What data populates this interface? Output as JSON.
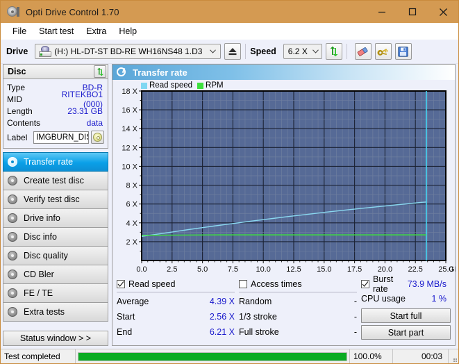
{
  "window": {
    "title": "Opti Drive Control 1.70",
    "icon": "disc-icon",
    "minimize": "minimize-icon",
    "maximize": "maximize-icon",
    "close": "close-icon",
    "titlebar_color": "#d49a52"
  },
  "menu": {
    "items": [
      {
        "label": "File"
      },
      {
        "label": "Start test"
      },
      {
        "label": "Extra"
      },
      {
        "label": "Help"
      }
    ]
  },
  "toolbar": {
    "drive_label": "Drive",
    "drive_value": "(H:)  HL-DT-ST BD-RE  WH16NS48 1.D3",
    "eject_icon": "eject-icon",
    "speed_label": "Speed",
    "speed_value": "6.2 X",
    "refresh_icon": "refresh-icon",
    "erase_icon": "eraser-icon",
    "keys_icon": "keys-icon",
    "save_icon": "save-icon"
  },
  "disc_panel": {
    "title": "Disc",
    "refresh_icon": "refresh-icon",
    "rows": [
      {
        "key": "Type",
        "value": "BD-R"
      },
      {
        "key": "MID",
        "value": "RITEKBO1 (000)"
      },
      {
        "key": "Length",
        "value": "23.31 GB"
      },
      {
        "key": "Contents",
        "value": "data"
      }
    ],
    "label_key": "Label",
    "label_value": "IMGBURN_DIS",
    "label_icon": "cd-icon"
  },
  "sidebar": {
    "items": [
      {
        "label": "Transfer rate",
        "active": true
      },
      {
        "label": "Create test disc",
        "active": false
      },
      {
        "label": "Verify test disc",
        "active": false
      },
      {
        "label": "Drive info",
        "active": false
      },
      {
        "label": "Disc info",
        "active": false
      },
      {
        "label": "Disc quality",
        "active": false
      },
      {
        "label": "CD Bler",
        "active": false
      },
      {
        "label": "FE / TE",
        "active": false
      },
      {
        "label": "Extra tests",
        "active": false
      }
    ],
    "status_window_label": "Status window > >"
  },
  "main": {
    "header_title": "Transfer rate",
    "header_icon": "transfer-rate-icon"
  },
  "chart_data": {
    "type": "line",
    "title": "Transfer rate",
    "xlabel": "GB",
    "ylabel": "X",
    "xlim": [
      0.0,
      25.0
    ],
    "ylim": [
      0,
      18
    ],
    "xticks": [
      "0.0",
      "2.5",
      "5.0",
      "7.5",
      "10.0",
      "12.5",
      "15.0",
      "17.5",
      "20.0",
      "22.5",
      "25.0"
    ],
    "xtick_values": [
      0.0,
      2.5,
      5.0,
      7.5,
      10.0,
      12.5,
      15.0,
      17.5,
      20.0,
      22.5,
      25.0
    ],
    "yticks": [
      "2 X",
      "4 X",
      "6 X",
      "8 X",
      "10 X",
      "12 X",
      "14 X",
      "16 X",
      "18 X"
    ],
    "ytick_values": [
      2,
      4,
      6,
      8,
      10,
      12,
      14,
      16,
      18
    ],
    "grid": true,
    "x_unit": "GB",
    "plot_bg": "#566a96",
    "legend_position": "top-left",
    "legend": [
      {
        "name": "Read speed",
        "color": "#7fd7f2"
      },
      {
        "name": "RPM",
        "color": "#3de03d"
      }
    ],
    "series": [
      {
        "name": "Read speed",
        "color": "#8ad8f0",
        "x": [
          0.0,
          1.0,
          2.0,
          3.0,
          4.0,
          5.0,
          6.0,
          7.0,
          8.0,
          9.0,
          10.0,
          11.0,
          12.0,
          13.0,
          14.0,
          15.0,
          16.0,
          17.0,
          18.0,
          19.0,
          20.0,
          21.0,
          22.0,
          23.0,
          23.4
        ],
        "y": [
          2.56,
          2.74,
          2.93,
          3.12,
          3.31,
          3.49,
          3.67,
          3.84,
          4.01,
          4.18,
          4.34,
          4.5,
          4.66,
          4.81,
          4.96,
          5.11,
          5.25,
          5.39,
          5.53,
          5.66,
          5.79,
          5.92,
          6.04,
          6.17,
          6.21
        ]
      },
      {
        "name": "RPM",
        "color": "#3de03d",
        "x": [
          0.0,
          6.4,
          23.4
        ],
        "y": [
          2.68,
          2.72,
          2.72
        ]
      }
    ],
    "markers": [
      {
        "type": "vline",
        "x": 23.4,
        "color": "#45d8f5"
      }
    ]
  },
  "stats": {
    "read_speed": {
      "checkbox_label": "Read speed",
      "checked": true,
      "rows": [
        {
          "key": "Average",
          "value": "4.39 X"
        },
        {
          "key": "Start",
          "value": "2.56 X"
        },
        {
          "key": "End",
          "value": "6.21 X"
        }
      ]
    },
    "access_times": {
      "checkbox_label": "Access times",
      "checked": false,
      "rows": [
        {
          "key": "Random",
          "value": "-"
        },
        {
          "key": "1/3 stroke",
          "value": "-"
        },
        {
          "key": "Full stroke",
          "value": "-"
        }
      ]
    },
    "burst": {
      "checkbox_label": "Burst rate",
      "checked": true,
      "value": "73.9 MB/s",
      "cpu_key": "CPU usage",
      "cpu_value": "1 %",
      "start_full_label": "Start full",
      "start_part_label": "Start part"
    }
  },
  "statusbar": {
    "message": "Test completed",
    "progress_percent": 100.0,
    "progress_text": "100.0%",
    "elapsed": "00:03",
    "progress_color": "#0bac23"
  }
}
